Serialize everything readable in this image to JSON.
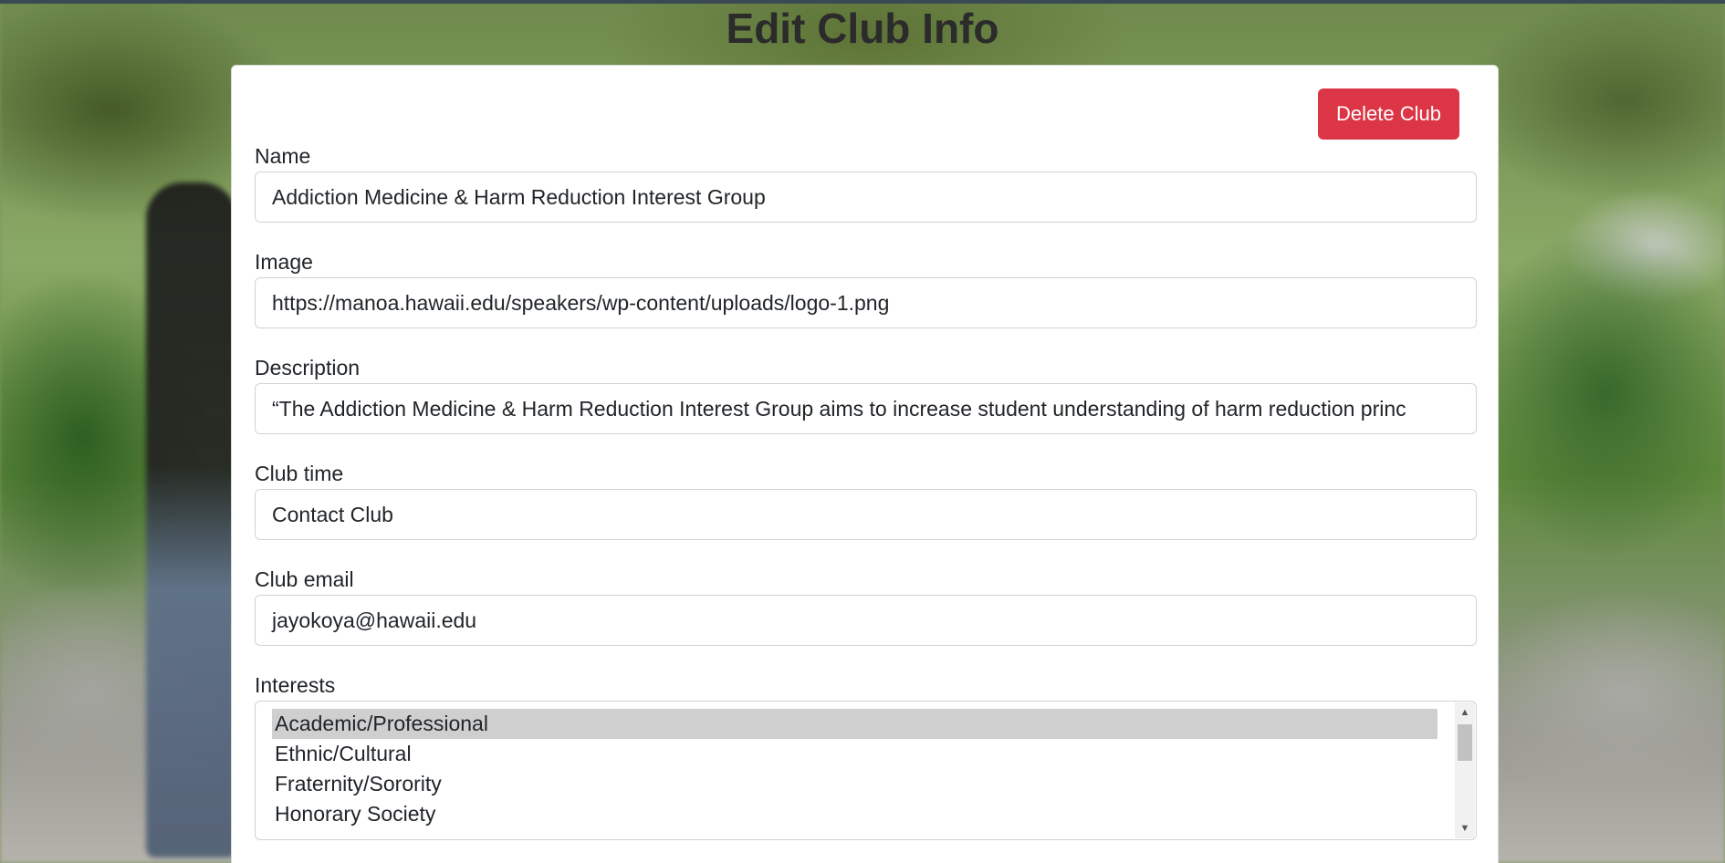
{
  "page": {
    "title": "Edit Club Info"
  },
  "actions": {
    "delete_label": "Delete Club"
  },
  "form": {
    "name": {
      "label": "Name",
      "value": "Addiction Medicine & Harm Reduction Interest Group"
    },
    "image": {
      "label": "Image",
      "value": "https://manoa.hawaii.edu/speakers/wp-content/uploads/logo-1.png"
    },
    "description": {
      "label": "Description",
      "value": "“The Addiction Medicine & Harm Reduction Interest Group aims to increase student understanding of harm reduction princ"
    },
    "club_time": {
      "label": "Club time",
      "value": "Contact Club"
    },
    "club_email": {
      "label": "Club email",
      "value": "jayokoya@hawaii.edu"
    },
    "interests": {
      "label": "Interests",
      "options": [
        "Academic/Professional",
        "Ethnic/Cultural",
        "Fraternity/Sorority",
        "Honorary Society"
      ],
      "selected": "Academic/Professional"
    }
  },
  "colors": {
    "danger": "#dc3545",
    "selected_option": "#cfcfcf"
  }
}
